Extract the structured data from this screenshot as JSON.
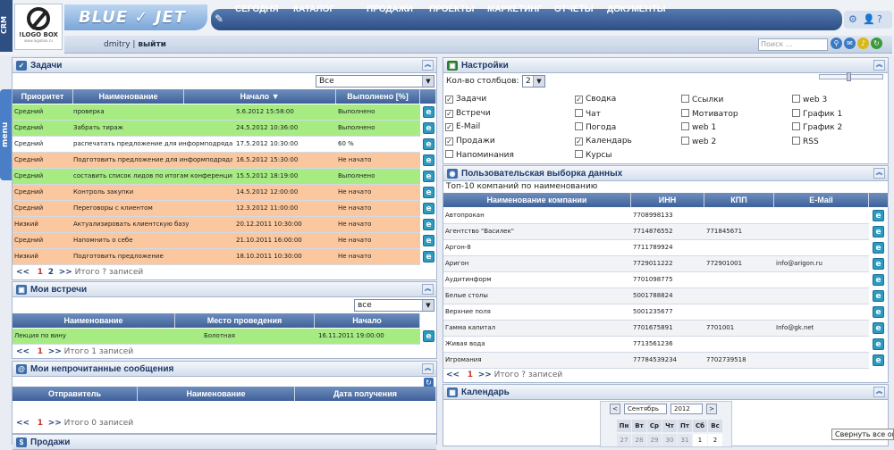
{
  "app": {
    "crm": "CRM",
    "brand": "BLUE ✓ JET",
    "logo_text": "!LOGO BOX",
    "logo_sub": "www.logobox.ru"
  },
  "nav": [
    "СЕГОДНЯ",
    "КАТАЛОГ",
    "ПРОДАЖИ",
    "ПРОЕКТЫ",
    "МАРКЕТИНГ",
    "ОТЧЕТЫ",
    "ДОКУМЕНТЫ"
  ],
  "user": {
    "name": "dmitry",
    "logout": "выйти",
    "search_placeholder": "Поиск ..."
  },
  "menu_tab": "menu",
  "tasks": {
    "title": "Задачи",
    "filter": "Все",
    "headers": [
      "Приоритет",
      "Наименование",
      "Начало ▼",
      "Выполнено [%]"
    ],
    "rows": [
      {
        "p": "Средний",
        "n": "проверка",
        "s": "5.6.2012 15:58:00",
        "d": "Выполнено",
        "c": "g"
      },
      {
        "p": "Средний",
        "n": "Забрать тираж",
        "s": "24.5.2012 10:36:00",
        "d": "Выполнено",
        "c": "g"
      },
      {
        "p": "Средний",
        "n": "распечатать предложение для информподряда",
        "s": "17.5.2012 10:30:00",
        "d": "60 %",
        "c": "w"
      },
      {
        "p": "Средний",
        "n": "Подготовить предложение для информподряда",
        "s": "16.5.2012 15:30:00",
        "d": "Не начато",
        "c": "o"
      },
      {
        "p": "Средний",
        "n": "составить список лидов по итогам конференции",
        "s": "15.5.2012 18:19:00",
        "d": "Выполнено",
        "c": "g"
      },
      {
        "p": "Средний",
        "n": "Контроль закупки",
        "s": "14.5.2012 12:00:00",
        "d": "Не начато",
        "c": "o"
      },
      {
        "p": "Средний",
        "n": "Переговоры с клиентом",
        "s": "12.3.2012 11:00:00",
        "d": "Не начато",
        "c": "o"
      },
      {
        "p": "Низкий",
        "n": "Актуализировать клиентскую базу",
        "s": "20.12.2011 10:30:00",
        "d": "Не начато",
        "c": "o"
      },
      {
        "p": "Средний",
        "n": "Напомнить о себе",
        "s": "21.10.2011 16:00:00",
        "d": "Не начато",
        "c": "o"
      },
      {
        "p": "Низкий",
        "n": "Подготовить предложение",
        "s": "18.10.2011 10:30:00",
        "d": "Не начато",
        "c": "o"
      }
    ],
    "pager": {
      "prev": "<<",
      "p1": "1",
      "p2": "2",
      "next": ">>",
      "total": "Итого ? записей"
    }
  },
  "meetings": {
    "title": "Мои встречи",
    "filter": "все",
    "headers": [
      "Наименование",
      "Место проведения",
      "Начало"
    ],
    "row": {
      "n": "Лекция по вину",
      "l": "Болотная",
      "s": "16.11.2011 19:00:00"
    },
    "pager": {
      "prev": "<<",
      "p1": "1",
      "next": ">>",
      "total": "Итого 1 записей"
    }
  },
  "messages": {
    "title": "Мои непрочитанные сообщения",
    "headers": [
      "Отправитель",
      "Наименование",
      "Дата получения"
    ],
    "pager": {
      "prev": "<<",
      "p1": "1",
      "next": ">>",
      "total": "Итого 0 записей"
    }
  },
  "sales": {
    "title": "Продажи"
  },
  "settings": {
    "title": "Настройки",
    "cols_label": "Кол-во столбцов:",
    "cols_value": "2",
    "items": [
      {
        "l": "Задачи",
        "c": true
      },
      {
        "l": "Сводка",
        "c": true
      },
      {
        "l": "Ссылки",
        "c": false
      },
      {
        "l": "web 3",
        "c": false
      },
      {
        "l": "Встречи",
        "c": true
      },
      {
        "l": "Чат",
        "c": false
      },
      {
        "l": "Мотиватор",
        "c": false
      },
      {
        "l": "График 1",
        "c": false
      },
      {
        "l": "E-Mail",
        "c": true
      },
      {
        "l": "Погода",
        "c": false
      },
      {
        "l": "web 1",
        "c": false
      },
      {
        "l": "График 2",
        "c": false
      },
      {
        "l": "Продажи",
        "c": true
      },
      {
        "l": "Календарь",
        "c": true
      },
      {
        "l": "web 2",
        "c": false
      },
      {
        "l": "RSS",
        "c": false
      },
      {
        "l": "Напоминания",
        "c": false
      },
      {
        "l": "Курсы",
        "c": false
      }
    ]
  },
  "custom": {
    "title": "Пользовательская выборка данных",
    "subtitle": "Топ-10 компаний по наименованию",
    "headers": [
      "Наименование компании",
      "ИНН",
      "КПП",
      "E-Mail"
    ],
    "rows": [
      {
        "n": "Автопрокан",
        "i": "7708998133",
        "k": "",
        "e": ""
      },
      {
        "n": "Агентство \"Василек\"",
        "i": "7714876552",
        "k": "771845671",
        "e": ""
      },
      {
        "n": "Аргон-8",
        "i": "7711789924",
        "k": "",
        "e": ""
      },
      {
        "n": "Аригон",
        "i": "7729011222",
        "k": "772901001",
        "e": "info@arigon.ru"
      },
      {
        "n": "Аудитинформ",
        "i": "7701098775",
        "k": "",
        "e": ""
      },
      {
        "n": "Белые столы",
        "i": "5001788824",
        "k": "",
        "e": ""
      },
      {
        "n": "Верхние поля",
        "i": "5001235677",
        "k": "",
        "e": ""
      },
      {
        "n": "Гамма капитал",
        "i": "7701675891",
        "k": "7701001",
        "e": "Info@gk.net"
      },
      {
        "n": "Живая вода",
        "i": "7713561236",
        "k": "",
        "e": ""
      },
      {
        "n": "Игромания",
        "i": "77784539234",
        "k": "7702739518",
        "e": ""
      }
    ],
    "pager": {
      "prev": "<<",
      "p1": "1",
      "next": ">>",
      "total": "Итого ? записей"
    }
  },
  "calendar": {
    "title": "Календарь",
    "month": "Сентябрь",
    "year": "2012",
    "days": [
      "Пн",
      "Вт",
      "Ср",
      "Чт",
      "Пт",
      "Сб",
      "Вс"
    ],
    "first_row": [
      "27",
      "28",
      "29",
      "30",
      "31",
      "1",
      "2"
    ]
  },
  "tooltip": "Свернуть все окна",
  "colors": {
    "green": "#a6ec83",
    "orange": "#fbc79e",
    "white": "#ffffff",
    "accent": "#2e4f82"
  }
}
